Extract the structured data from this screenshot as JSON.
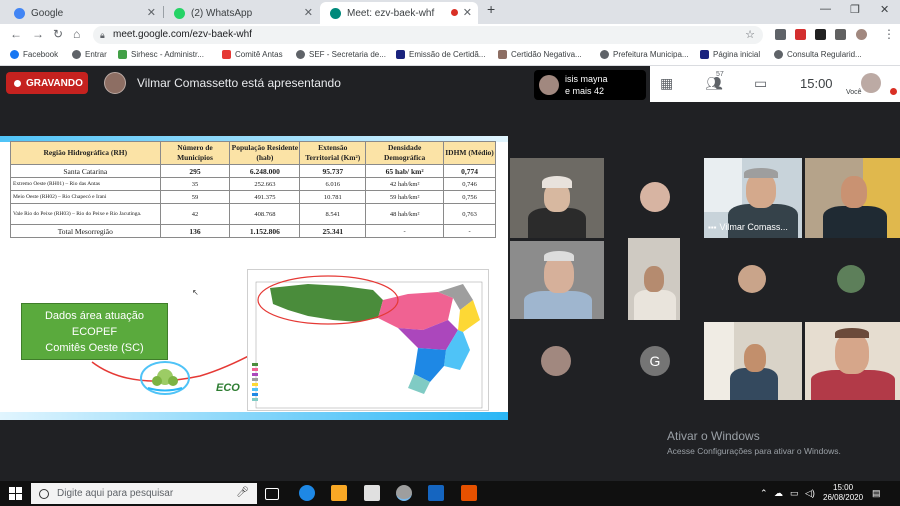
{
  "browser": {
    "tabs": [
      {
        "title": "Google",
        "favicon_color": "#4285f4",
        "active": false
      },
      {
        "title": "(2) WhatsApp",
        "favicon_color": "#25d366",
        "active": false
      },
      {
        "title": "Meet: ezv-baek-whf",
        "favicon_color": "#00897b",
        "active": true
      }
    ],
    "new_tab_icon": "plus-icon",
    "url": "meet.google.com/ezv-baek-whf",
    "bookmarks": [
      {
        "label": "Facebook",
        "color": "#1877f2"
      },
      {
        "label": "Entrar",
        "color": "#5f6368"
      },
      {
        "label": "Sirhesc - Administr...",
        "color": "#43a047"
      },
      {
        "label": "Comitê Antas",
        "color": "#e53935"
      },
      {
        "label": "SEF - Secretaria de...",
        "color": "#5f6368"
      },
      {
        "label": "Emissão de Certidã...",
        "color": "#1a237e"
      },
      {
        "label": "Certidão Negativa...",
        "color": "#8d6e63"
      },
      {
        "label": "Prefeitura Municipa...",
        "color": "#5f6368"
      },
      {
        "label": "Página inicial",
        "color": "#1a237e"
      },
      {
        "label": "Consulta Regularid...",
        "color": "#5f6368"
      }
    ]
  },
  "meet": {
    "recording_label": "GRAVANDO",
    "presenting_text": "Vilmar Comassetto está apresentando",
    "participant_line1": "isis mayna",
    "participant_line2": "e mais 42",
    "people_count": "57",
    "time": "15:00",
    "self_label": "Você",
    "vilmar_tile_label": "Vilmar Comass...",
    "g_avatar_letter": "G"
  },
  "slide": {
    "table": {
      "headers": [
        "Região Hidrográfica (RH)",
        "Número de Municípios",
        "População Residente (hab)",
        "Extensão Territorial (Km²)",
        "Densidade Demográfica",
        "IDHM (Médio)"
      ],
      "rows": [
        [
          "Santa Catarina",
          "295",
          "6.248.000",
          "95.737",
          "65 hab/ km²",
          "0,774"
        ],
        [
          "Extremo Oeste (RH01) – Rio das Antas",
          "35",
          "252.663",
          "6.016",
          "42 hab/km²",
          "0,746"
        ],
        [
          "Meio Oeste (RH02) – Rio Chapecó e Irani",
          "59",
          "491.375",
          "10.781",
          "59 hab/km²",
          "0,756"
        ],
        [
          "Vale Rio do Peixe (RH03) – Rio do Peixe e Rio Jacutinga.",
          "42",
          "408.768",
          "8.541",
          "48 hab/km²",
          "0,763"
        ],
        [
          "Total Mesorregião",
          "136",
          "1.152.806",
          "25.341",
          "-",
          "-"
        ]
      ]
    },
    "green_box_lines": [
      "Dados área atuação",
      "ECOPEF",
      "Comitês Oeste (SC)"
    ],
    "logo_text": "ECO"
  },
  "windows": {
    "activate_title": "Ativar o Windows",
    "activate_sub": "Acesse Configurações para ativar o Windows.",
    "search_placeholder": "Digite aqui para pesquisar",
    "clock_time": "15:00",
    "clock_date": "26/08/2020"
  }
}
